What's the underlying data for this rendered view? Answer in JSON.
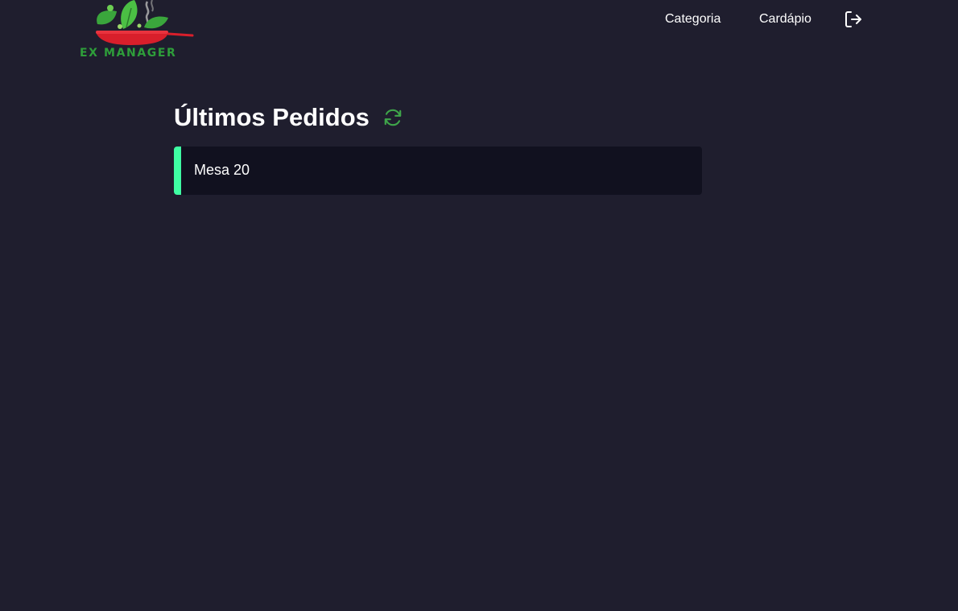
{
  "brand": {
    "name": "EX MANAGER"
  },
  "nav": {
    "items": [
      {
        "label": "Categoria"
      },
      {
        "label": "Cardápio"
      }
    ],
    "logout_icon": "logout-icon"
  },
  "main": {
    "title": "Últimos Pedidos",
    "refresh_icon": "refresh-icon",
    "orders": [
      {
        "label": "Mesa 20"
      }
    ]
  },
  "colors": {
    "background": "#1f1e2e",
    "card": "#11111f",
    "accent": "#3fffa3",
    "refresh": "#3fa54a",
    "logo_green": "#2e9e3a",
    "logo_red": "#d81f2b"
  }
}
